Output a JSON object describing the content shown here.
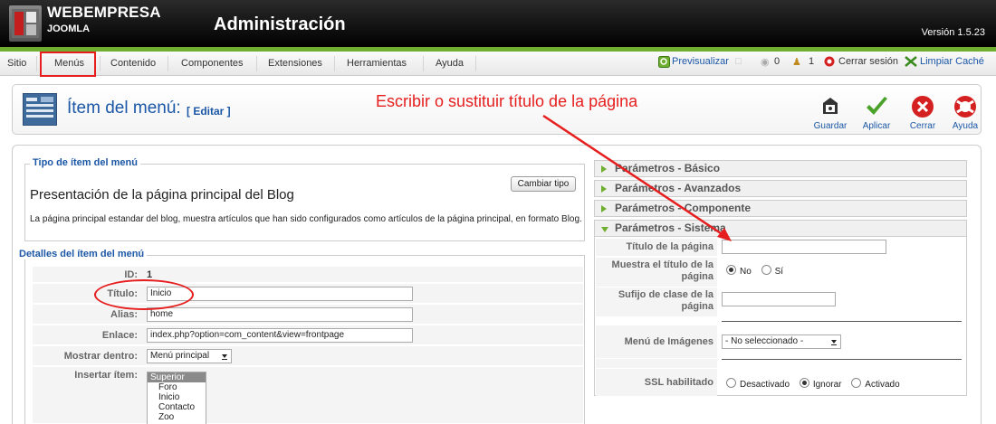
{
  "header": {
    "brand_name": "WEBEMPRESA",
    "brand_sub": "JOOMLA",
    "app_title": "Administración",
    "version": "Versión 1.5.23"
  },
  "menu": {
    "items": [
      {
        "label": "Sitio"
      },
      {
        "label": "Menús"
      },
      {
        "label": "Contenido"
      },
      {
        "label": "Componentes"
      },
      {
        "label": "Extensiones"
      },
      {
        "label": "Herramientas"
      },
      {
        "label": "Ayuda"
      }
    ]
  },
  "status": {
    "preview": "Previsualizar",
    "messages_count": "0",
    "users_count": "1",
    "logout": "Cerrar sesión",
    "clear_cache": "Limpiar Caché"
  },
  "toolbar": {
    "title": "Ítem del menú:",
    "title_sub": "[ Editar ]",
    "annotation": "Escribir o sustituir título de la página",
    "buttons": [
      {
        "label": "Guardar",
        "icon": "save-icon"
      },
      {
        "label": "Aplicar",
        "icon": "apply-check-icon"
      },
      {
        "label": "Cerrar",
        "icon": "close-icon"
      },
      {
        "label": "Ayuda",
        "icon": "help-lifebuoy-icon"
      }
    ]
  },
  "menu_type": {
    "legend": "Tipo de ítem del menú",
    "title": "Presentación de la página principal del Blog",
    "change_button": "Cambiar tipo",
    "description": "La página principal estandar del blog, muestra artículos que han sido configurados como artículos de la página principal, en formato Blog."
  },
  "details": {
    "legend": "Detalles del ítem del menú",
    "id_label": "ID:",
    "id_value": "1",
    "title_label": "Título:",
    "title_value": "Inicio",
    "alias_label": "Alias:",
    "alias_value": "home",
    "link_label": "Enlace:",
    "link_value": "index.php?option=com_content&view=frontpage",
    "show_in_label": "Mostrar dentro:",
    "show_in_value": "Menú principal",
    "insert_label": "Insertar ítem:",
    "insert_options": [
      "Superior",
      "Foro",
      "Inicio",
      "Contacto",
      "Zoo"
    ]
  },
  "params": {
    "basic": "Parámetros - Básico",
    "advanced": "Parámetros - Avanzados",
    "component": "Parámetros - Componente",
    "system": "Parámetros - Sistema",
    "page_title_label": "Título de la página",
    "page_title_value": "",
    "show_title_label": "Muestra el título de la página",
    "show_title_no": "No",
    "show_title_yes": "Sí",
    "suffix_label": "Sufijo de clase de la página",
    "image_menu_label": "Menú de Imágenes",
    "image_menu_value": "- No seleccionado -",
    "ssl_label": "SSL habilitado",
    "ssl_off": "Desactivado",
    "ssl_ignore": "Ignorar",
    "ssl_on": "Activado"
  },
  "colors": {
    "accent_link": "#1b57a6",
    "annotation_red": "#e61e1e",
    "joomla_green": "#6fae2e"
  }
}
